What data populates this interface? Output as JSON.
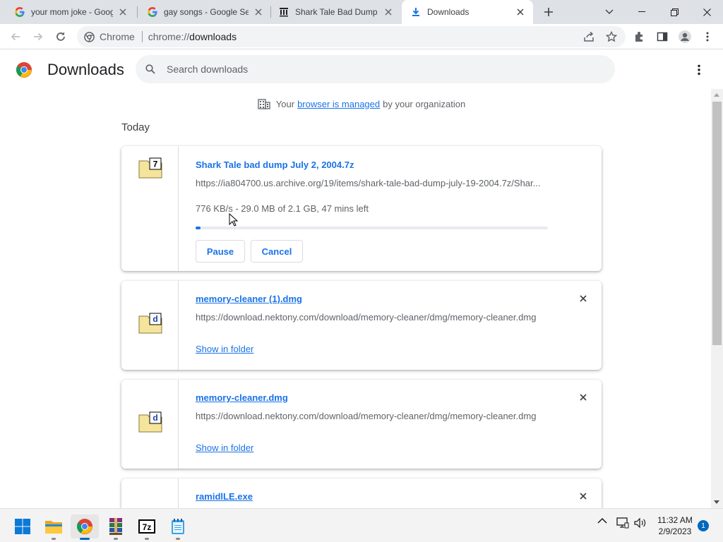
{
  "browser": {
    "tabs": [
      {
        "title": "your mom joke - Goog",
        "favicon": "google-g-icon"
      },
      {
        "title": "gay songs - Google Se",
        "favicon": "google-g-icon"
      },
      {
        "title": "Shark Tale Bad Dump J",
        "favicon": "archive-org-icon"
      },
      {
        "title": "Downloads",
        "favicon": "download-icon"
      }
    ],
    "active_tab": 3,
    "omnibox": {
      "chip": "Chrome",
      "url_scheme": "chrome://",
      "url_path": "downloads"
    }
  },
  "downloads_page": {
    "title": "Downloads",
    "search_placeholder": "Search downloads",
    "managed": {
      "prefix": "Your",
      "link": "browser is managed",
      "suffix": "by your organization"
    },
    "section_label": "Today",
    "items": [
      {
        "name": "Shark Tale bad dump July 2, 2004.7z",
        "url": "https://ia804700.us.archive.org/19/items/shark-tale-bad-dump-july-19-2004.7z/Shar...",
        "status": "776 KB/s - 29.0 MB of 2.1 GB, 47 mins left",
        "progress": 0.0138,
        "buttons": {
          "pause": "Pause",
          "cancel": "Cancel"
        },
        "icon_glyph": "7"
      },
      {
        "name": "memory-cleaner (1).dmg",
        "url": "https://download.nektony.com/download/memory-cleaner/dmg/memory-cleaner.dmg",
        "action": "Show in folder",
        "icon_glyph": "d"
      },
      {
        "name": "memory-cleaner.dmg",
        "url": "https://download.nektony.com/download/memory-cleaner/dmg/memory-cleaner.dmg",
        "action": "Show in folder",
        "icon_glyph": "d"
      },
      {
        "name": "ramidlLE.exe"
      }
    ]
  },
  "taskbar": {
    "apps": [
      "start-icon",
      "file-explorer-icon",
      "chrome-icon",
      "winrar-icon",
      "7zip-icon",
      "notepad-icon"
    ],
    "sevenzip_label": "7z",
    "time": "11:32 AM",
    "date": "2/9/2023",
    "notification_count": "1"
  },
  "colors": {
    "accent": "#1a73e8",
    "tabstrip": "#dee1e6",
    "text_secondary": "#5f6368"
  }
}
